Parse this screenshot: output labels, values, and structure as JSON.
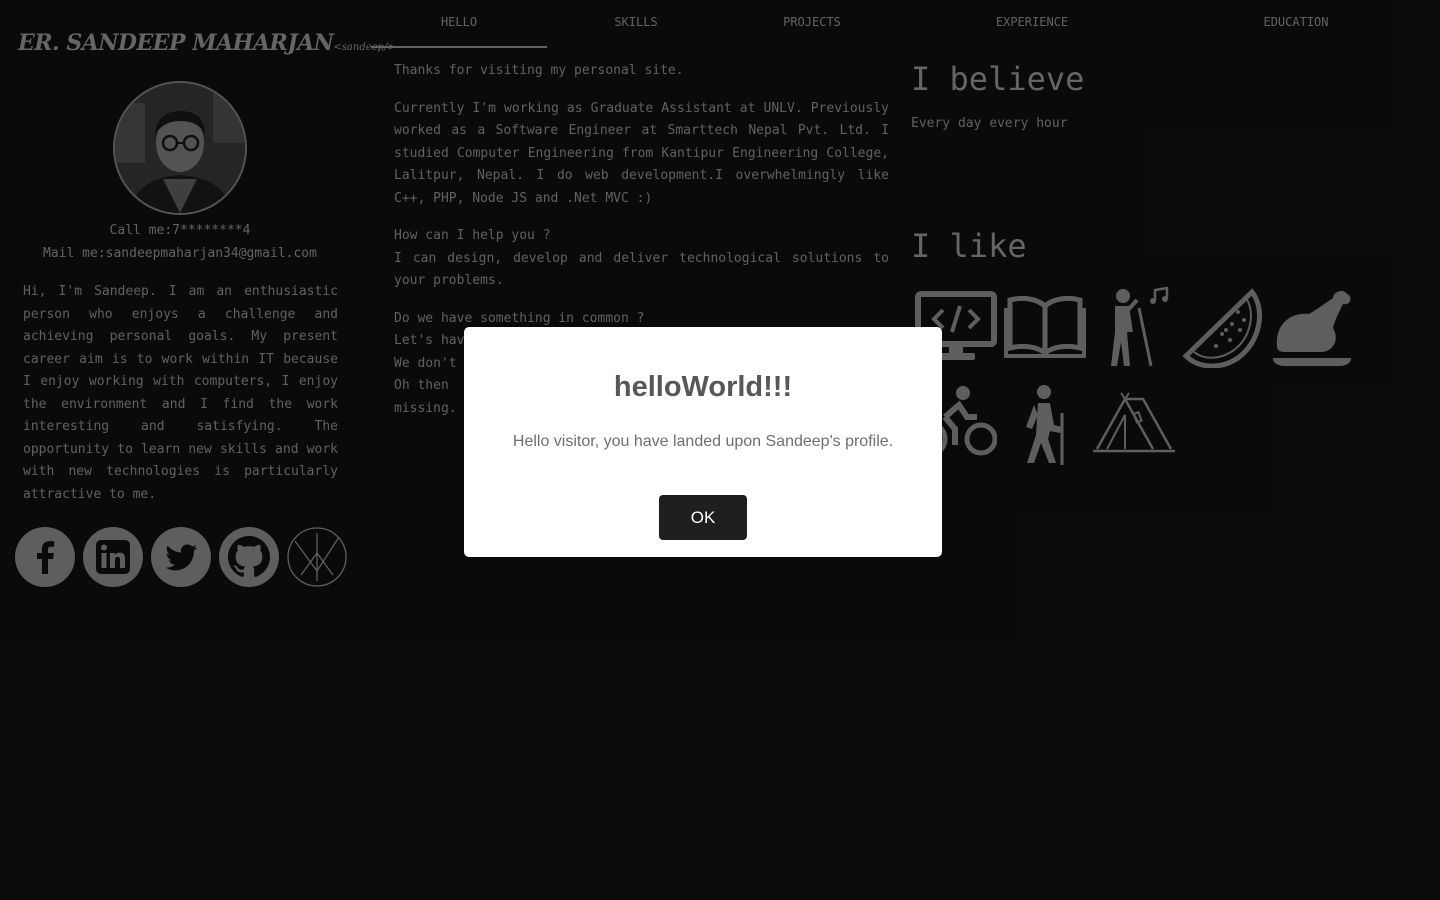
{
  "brand": {
    "name": "ER. SANDEEP MAHARJAN",
    "tag": "<sandeep/>"
  },
  "contact": {
    "call": "Call me:7********4",
    "mail": "Mail me:sandeepmaharjan34@gmail.com"
  },
  "bio": "Hi, I'm Sandeep. I am an enthusiastic person who enjoys a challenge and achieving personal goals. My present career aim is to work within IT because I enjoy working with computers, I enjoy the environment and I find the work interesting and satisfying. The opportunity to learn new skills and work with new technologies is particularly attractive to me.",
  "socials": [
    "facebook-icon",
    "linkedin-icon",
    "twitter-icon",
    "github-icon",
    "website-logo-icon"
  ],
  "nav": {
    "tabs": [
      "HELLO",
      "SKILLS",
      "PROJECTS",
      "EXPERIENCE",
      "EDUCATION"
    ],
    "active": "HELLO"
  },
  "main": {
    "p1": "Thanks for visiting my personal site.",
    "p2": "Currently I'm working as Graduate Assistant at UNLV. Previously worked as a Software Engineer at Smarttech Nepal Pvt. Ltd. I studied Computer Engineering from Kantipur Engineering College, Lalitpur, Nepal. I do web development.I overwhelmingly like C++, PHP, Node JS and .Net MVC :)",
    "p3_q": "How can I help you ?",
    "p3_a": "I can design, develop and deliver technological solutions to your problems.",
    "p4_l1": "Do we have something in common ?",
    "p4_l2": "Let's have",
    "p4_l3": "We don't",
    "p4_l4": "Oh then",
    "p4_l5": "missing."
  },
  "believe": {
    "heading": "I believe",
    "text": "Every day every hour"
  },
  "like": {
    "heading": "I like",
    "icons": [
      "coding-icon",
      "book-icon",
      "singing-icon",
      "watermelon-icon",
      "chicken-icon",
      "cycling-icon",
      "hiking-icon",
      "tent-icon"
    ]
  },
  "modal": {
    "title": "helloWorld!!!",
    "message": "Hello visitor, you have landed upon Sandeep's profile.",
    "ok_label": "OK"
  }
}
